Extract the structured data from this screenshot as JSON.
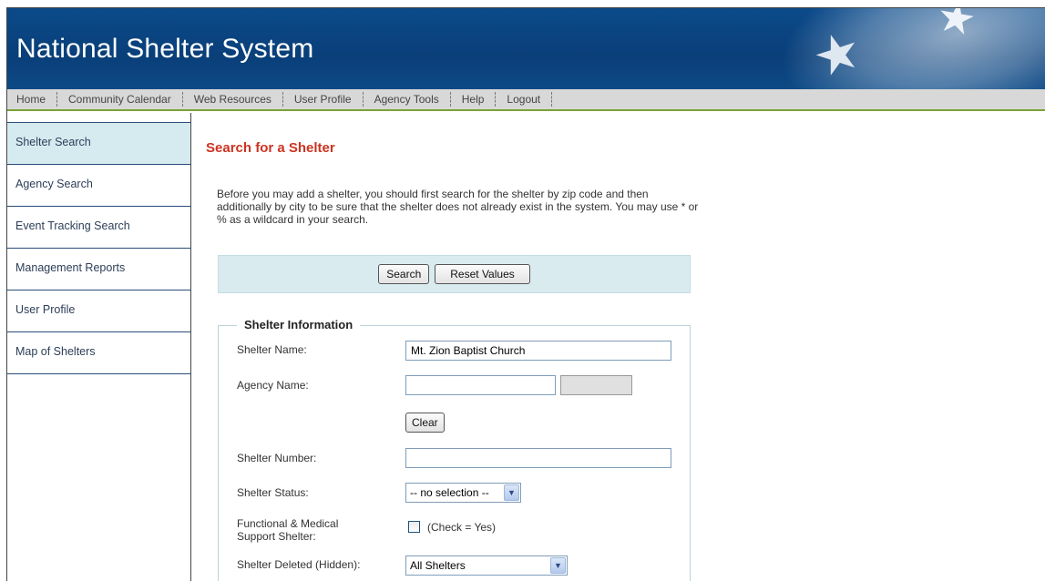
{
  "header": {
    "title": "National Shelter System"
  },
  "nav": [
    "Home",
    "Community Calendar",
    "Web Resources",
    "User Profile",
    "Agency Tools",
    "Help",
    "Logout"
  ],
  "sidebar": {
    "items": [
      {
        "label": "Shelter Search"
      },
      {
        "label": "Agency Search"
      },
      {
        "label": "Event Tracking Search"
      },
      {
        "label": "Management Reports"
      },
      {
        "label": "User Profile"
      },
      {
        "label": "Map of Shelters"
      }
    ]
  },
  "main": {
    "title": "Search for a Shelter",
    "intro": "Before you may add a shelter, you should first search for the shelter by zip code and then additionally by city to be sure that the shelter does not already exist in the system. You may use * or % as a wildcard in your search.",
    "buttons": {
      "search": "Search",
      "reset": "Reset Values"
    }
  },
  "form": {
    "legend": "Shelter Information",
    "shelter_name": {
      "label": "Shelter Name:",
      "value": "Mt. Zion Baptist Church"
    },
    "agency_name": {
      "label": "Agency Name:",
      "value": "",
      "code": "",
      "clear": "Clear"
    },
    "shelter_number": {
      "label": "Shelter Number:",
      "value": ""
    },
    "shelter_status": {
      "label": "Shelter Status:",
      "selected": "-- no selection --"
    },
    "functional_medical": {
      "label_line1": "Functional & Medical",
      "label_line2": "Support Shelter:",
      "checkbox_text": "(Check = Yes)",
      "checked": false
    },
    "shelter_deleted": {
      "label": "Shelter Deleted (Hidden):",
      "selected": "All Shelters"
    }
  },
  "icons": {
    "banner_decor": "star-icon",
    "dropdown": "chevron-down-icon"
  },
  "colors": {
    "banner": "#0b4a8a",
    "title_red": "#cc3322",
    "nav_underline": "#7aa33a",
    "active_sidebar": "#d6ebf0"
  }
}
